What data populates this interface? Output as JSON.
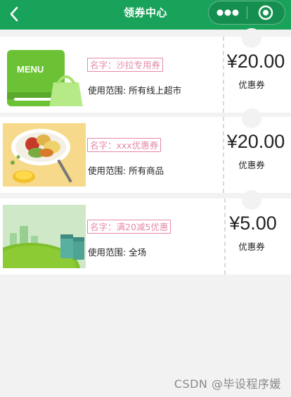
{
  "header": {
    "title": "领券中心"
  },
  "coupons": [
    {
      "name": "名字：沙拉专用券",
      "scope": "使用范围: 所有线上超市",
      "price": "¥20.00",
      "type": "优惠券"
    },
    {
      "name": "名字：xxx优惠券",
      "scope": "使用范围: 所有商品",
      "price": "¥20.00",
      "type": "优惠券"
    },
    {
      "name": "名字：满20减5优惠",
      "scope": "使用范围: 全场",
      "price": "¥5.00",
      "type": "优惠券"
    }
  ],
  "watermark": "CSDN @毕设程序媛",
  "colors": {
    "header_bg": "#19a35a",
    "name_tag": "#e58aa8",
    "page_bg": "#f2f2f2"
  }
}
